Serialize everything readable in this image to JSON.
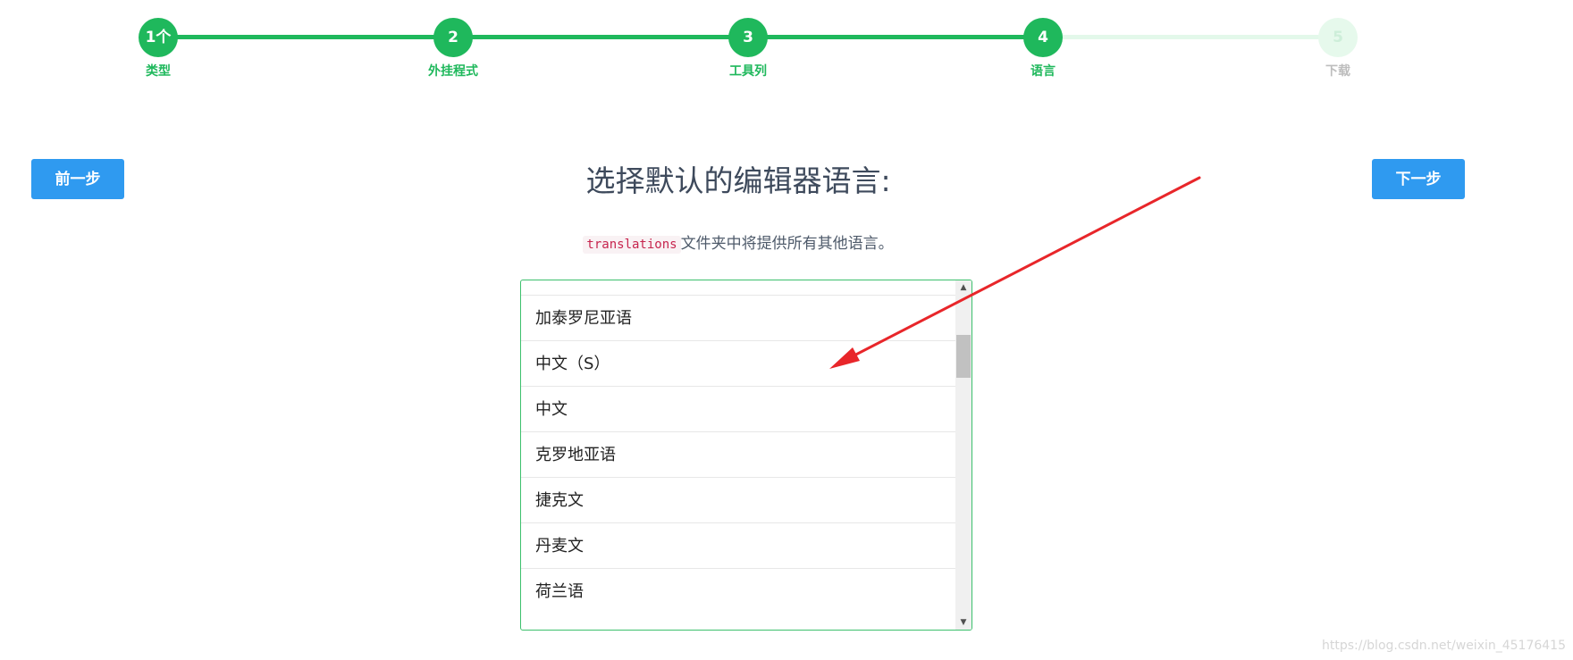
{
  "stepper": {
    "steps": [
      {
        "number": "1个",
        "label": "类型",
        "state": "done"
      },
      {
        "number": "2",
        "label": "外挂程式",
        "state": "done"
      },
      {
        "number": "3",
        "label": "工具列",
        "state": "done"
      },
      {
        "number": "4",
        "label": "语言",
        "state": "done"
      },
      {
        "number": "5",
        "label": "下载",
        "state": "todo"
      }
    ],
    "colors": {
      "done": "#1fb85c",
      "todo": "#e6f9ec"
    }
  },
  "nav": {
    "prev_label": "前一步",
    "next_label": "下一步",
    "button_color": "#2f9af0"
  },
  "main": {
    "heading": "选择默认的编辑器语言:",
    "sub_code": "translations",
    "sub_text": "文件夹中将提供所有其他语言。"
  },
  "language_list": {
    "items": [
      "加泰罗尼亚语",
      "中文（S）",
      "中文",
      "克罗地亚语",
      "捷克文",
      "丹麦文",
      "荷兰语"
    ],
    "border_color": "#3cc06c"
  },
  "annotation": {
    "icon": "red-arrow-icon",
    "color": "#e8262a"
  },
  "watermark": "https://blog.csdn.net/weixin_45176415"
}
